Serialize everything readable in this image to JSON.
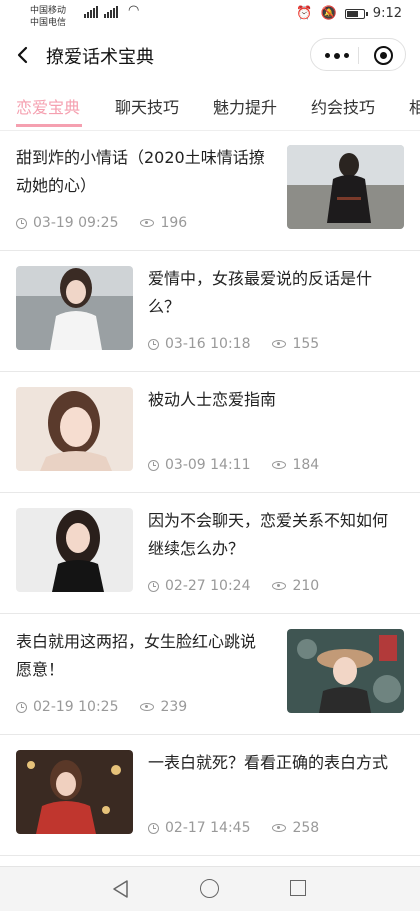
{
  "status_bar": {
    "carrier_1": "中国移动",
    "carrier_2": "中国电信",
    "time": "9:12"
  },
  "navbar": {
    "title": "撩爱话术宝典"
  },
  "tabs": [
    {
      "label": "恋爱宝典",
      "active": true
    },
    {
      "label": "聊天技巧",
      "active": false
    },
    {
      "label": "魅力提升",
      "active": false
    },
    {
      "label": "约会技巧",
      "active": false
    },
    {
      "label": "相",
      "active": false
    }
  ],
  "articles": [
    {
      "title": "甜到炸的小情话（2020土味情话撩动她的心）",
      "date": "03-19 09:25",
      "views": "196",
      "image_position": "right"
    },
    {
      "title": "爱情中，女孩最爱说的反话是什么？",
      "date": "03-16 10:18",
      "views": "155",
      "image_position": "left"
    },
    {
      "title": "被动人士恋爱指南",
      "date": "03-09 14:11",
      "views": "184",
      "image_position": "left"
    },
    {
      "title": "因为不会聊天，恋爱关系不知如何继续怎么办？",
      "date": "02-27 10:24",
      "views": "210",
      "image_position": "left"
    },
    {
      "title": "表白就用这两招，女生脸红心跳说愿意！",
      "date": "02-19 10:25",
      "views": "239",
      "image_position": "right"
    },
    {
      "title": "一表白就死？看看正确的表白方式",
      "date": "02-17 14:45",
      "views": "258",
      "image_position": "left"
    }
  ],
  "colors": {
    "accent": "#f5a0b0",
    "meta_text": "#999999"
  }
}
